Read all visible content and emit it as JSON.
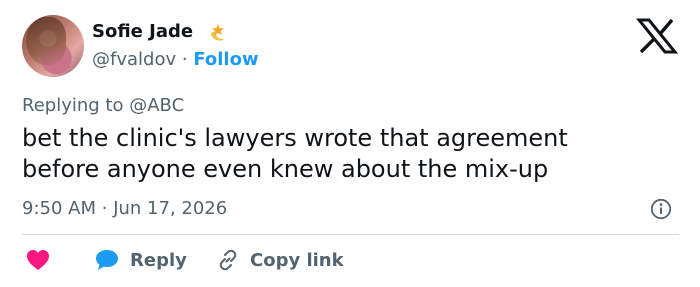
{
  "author": {
    "name": "Sofie Jade",
    "handle": "@fvaldov",
    "separator": "·",
    "follow_label": "Follow"
  },
  "reply_context": {
    "prefix": "Replying to",
    "mention": "@ABC"
  },
  "tweet": {
    "text_line1": "bet the clinic's lawyers wrote that agreement",
    "text_line2": "before anyone even knew about the mix-up",
    "time": "9:50 AM",
    "separator": "·",
    "date": "Jun 17, 2026"
  },
  "actions": {
    "reply_label": "Reply",
    "copy_link_label": "Copy link"
  },
  "colors": {
    "accent": "#1d9bf0",
    "like": "#f91880",
    "muted": "#536471",
    "text": "#0f1419"
  },
  "icons": {
    "badge": "star-moon-badge-icon",
    "logo": "x-logo-icon",
    "info": "info-icon",
    "like": "heart-icon",
    "reply": "speech-bubble-icon",
    "copy": "link-icon"
  }
}
